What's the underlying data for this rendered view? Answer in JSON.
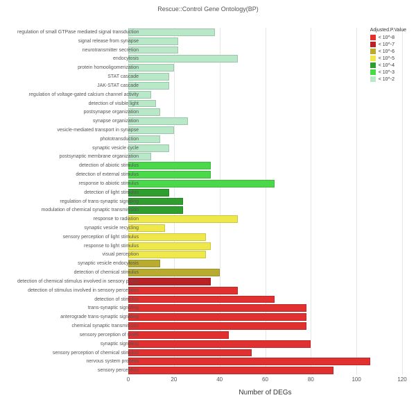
{
  "chart_data": {
    "type": "bar",
    "title": "Rescue::Control Gene Ontology(BP)",
    "xlabel": "Number of DEGs",
    "ylabel": "",
    "xlim": [
      0,
      120
    ],
    "ticks": [
      0,
      20,
      40,
      60,
      80,
      100,
      120
    ],
    "bars": [
      {
        "label": "regulation of small GTPase mediated signal transduction",
        "value": 38,
        "bin": "lt1e-2"
      },
      {
        "label": "signal release from synapse",
        "value": 22,
        "bin": "lt1e-2"
      },
      {
        "label": "neurotransmitter secretion",
        "value": 22,
        "bin": "lt1e-2"
      },
      {
        "label": "endocytosis",
        "value": 48,
        "bin": "lt1e-2"
      },
      {
        "label": "protein homooligomerization",
        "value": 20,
        "bin": "lt1e-2"
      },
      {
        "label": "STAT cascade",
        "value": 18,
        "bin": "lt1e-2"
      },
      {
        "label": "JAK-STAT cascade",
        "value": 18,
        "bin": "lt1e-2"
      },
      {
        "label": "regulation of voltage-gated calcium channel activity",
        "value": 10,
        "bin": "lt1e-2"
      },
      {
        "label": "detection of visible light",
        "value": 12,
        "bin": "lt1e-2"
      },
      {
        "label": "postsynapse organization",
        "value": 14,
        "bin": "lt1e-2"
      },
      {
        "label": "synapse organization",
        "value": 26,
        "bin": "lt1e-2"
      },
      {
        "label": "vesicle-mediated transport in synapse",
        "value": 20,
        "bin": "lt1e-2"
      },
      {
        "label": "phototransduction",
        "value": 14,
        "bin": "lt1e-2"
      },
      {
        "label": "synaptic vesicle cycle",
        "value": 18,
        "bin": "lt1e-2"
      },
      {
        "label": "postsynaptic membrane organization",
        "value": 10,
        "bin": "lt1e-2"
      },
      {
        "label": "detection of abiotic stimulus",
        "value": 36,
        "bin": "lt1e-3"
      },
      {
        "label": "detection of external stimulus",
        "value": 36,
        "bin": "lt1e-3"
      },
      {
        "label": "response to abiotic stimulus",
        "value": 64,
        "bin": "lt1e-3"
      },
      {
        "label": "detection of light stimulus",
        "value": 18,
        "bin": "lt1e-4"
      },
      {
        "label": "regulation of trans-synaptic signaling",
        "value": 24,
        "bin": "lt1e-4"
      },
      {
        "label": "modulation of chemical synaptic transmission",
        "value": 24,
        "bin": "lt1e-4"
      },
      {
        "label": "response to radiation",
        "value": 48,
        "bin": "lt1e-5"
      },
      {
        "label": "synaptic vesicle recycling",
        "value": 16,
        "bin": "lt1e-5"
      },
      {
        "label": "sensory perception of light stimulus",
        "value": 34,
        "bin": "lt1e-5"
      },
      {
        "label": "response to light stimulus",
        "value": 36,
        "bin": "lt1e-5"
      },
      {
        "label": "visual perception",
        "value": 34,
        "bin": "lt1e-5"
      },
      {
        "label": "synaptic vesicle endocytosis",
        "value": 14,
        "bin": "lt1e-6"
      },
      {
        "label": "detection of chemical stimulus",
        "value": 40,
        "bin": "lt1e-6"
      },
      {
        "label": "detection of chemical stimulus involved in sensory perception",
        "value": 36,
        "bin": "lt1e-7"
      },
      {
        "label": "detection of stimulus involved in sensory perception",
        "value": 48,
        "bin": "lt1e-8"
      },
      {
        "label": "detection of stimulus",
        "value": 64,
        "bin": "lt1e-8"
      },
      {
        "label": "trans-synaptic signaling",
        "value": 78,
        "bin": "lt1e-8"
      },
      {
        "label": "anterograde trans-synaptic signaling",
        "value": 78,
        "bin": "lt1e-8"
      },
      {
        "label": "chemical synaptic transmission",
        "value": 78,
        "bin": "lt1e-8"
      },
      {
        "label": "sensory perception of smell",
        "value": 44,
        "bin": "lt1e-8"
      },
      {
        "label": "synaptic signaling",
        "value": 80,
        "bin": "lt1e-8"
      },
      {
        "label": "sensory perception of chemical stimulus",
        "value": 54,
        "bin": "lt1e-8"
      },
      {
        "label": "nervous system process",
        "value": 106,
        "bin": "lt1e-8"
      },
      {
        "label": "sensory perception",
        "value": 90,
        "bin": "lt1e-8"
      }
    ],
    "legend": {
      "title": "Adjusted.P.Value",
      "items": [
        {
          "bin": "lt1e-8",
          "label": "< 10^-8",
          "color": "#e03130"
        },
        {
          "bin": "lt1e-7",
          "label": "< 10^-7",
          "color": "#b82226"
        },
        {
          "bin": "lt1e-6",
          "label": "< 10^-6",
          "color": "#b8ab2f"
        },
        {
          "bin": "lt1e-5",
          "label": "< 10^-5",
          "color": "#efe84a"
        },
        {
          "bin": "lt1e-4",
          "label": "< 10^-4",
          "color": "#2f9e2f"
        },
        {
          "bin": "lt1e-3",
          "label": "< 10^-3",
          "color": "#4bd84b"
        },
        {
          "bin": "lt1e-2",
          "label": "< 10^-2",
          "color": "#b8e8c8"
        }
      ]
    }
  }
}
